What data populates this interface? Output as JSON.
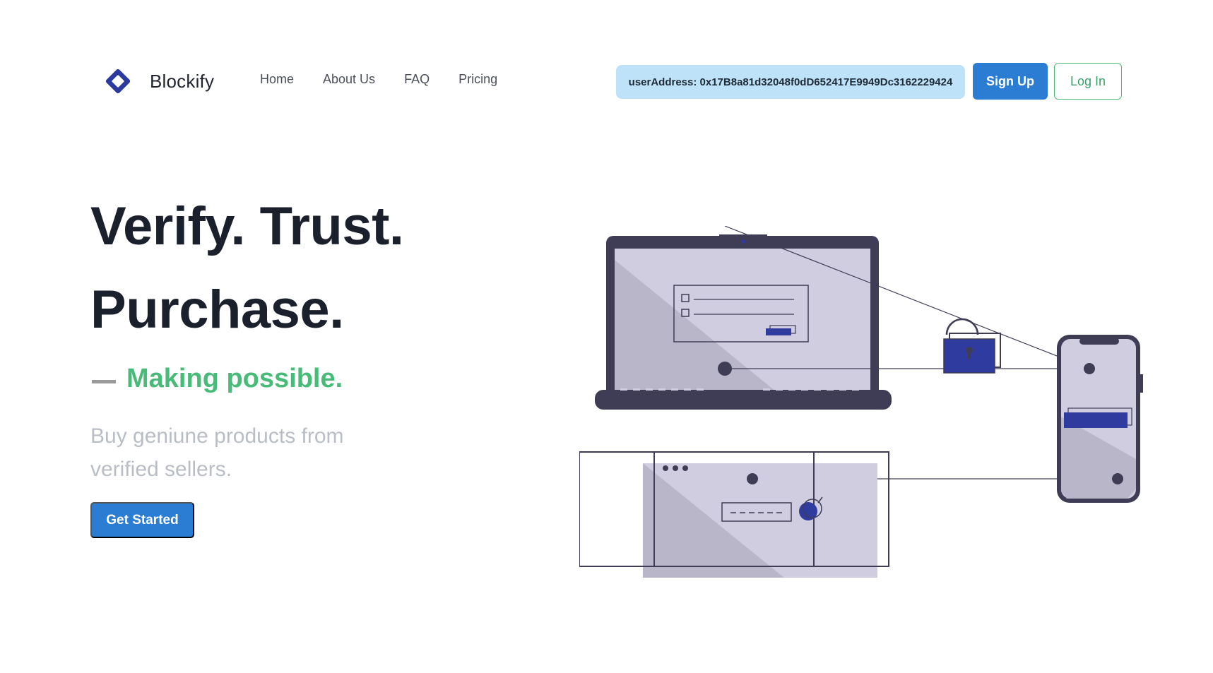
{
  "brand": {
    "name": "Blockify",
    "logo_icon": "diamond-logo-icon",
    "color": "#2b3a9e"
  },
  "nav": {
    "items": [
      {
        "label": "Home"
      },
      {
        "label": "About Us"
      },
      {
        "label": "FAQ"
      },
      {
        "label": "Pricing"
      }
    ]
  },
  "account": {
    "user_address": "userAddress: 0x17B8a81d32048f0dD652417E9949Dc3162229424",
    "signup_label": "Sign Up",
    "login_label": "Log In"
  },
  "hero": {
    "title_line1": "Verify. Trust.",
    "title_line2": "Purchase.",
    "tagline": "Making possible.",
    "description": "Buy geniune products from verified sellers.",
    "cta_label": "Get Started"
  },
  "colors": {
    "primary": "#2b7cd3",
    "accent_green": "#48bb78",
    "illustration_dark": "#3f3d56",
    "illustration_fill": "#d0cde1",
    "illustration_blue": "#2f3b9e"
  }
}
